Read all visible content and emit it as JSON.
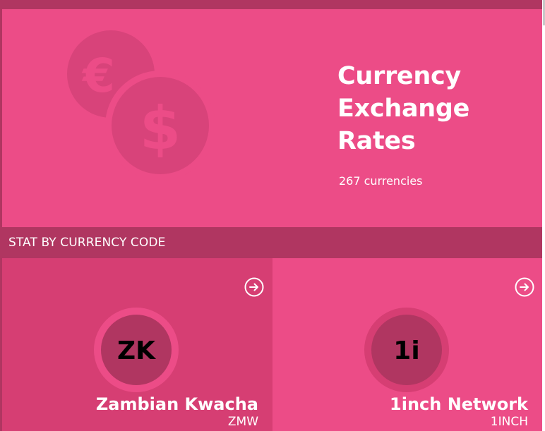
{
  "hero": {
    "title": "Currency Exchange Rates",
    "subtitle": "267 currencies",
    "icons": [
      "euro-coin-icon",
      "dollar-coin-icon"
    ],
    "glyph_euro": "€",
    "glyph_dollar": "$"
  },
  "section": {
    "title": "STAT BY CURRENCY CODE"
  },
  "cards": [
    {
      "badge": "ZK",
      "name": "Zambian Kwacha",
      "code": "ZMW",
      "icon": "arrow-right-circle-icon"
    },
    {
      "badge": "1i",
      "name": "1inch Network",
      "code": "1INCH",
      "icon": "arrow-right-circle-icon"
    }
  ],
  "colors": {
    "hero": "#ec4c87",
    "dark": "#b03661",
    "card_alt": "#d63e73",
    "text": "#ffffff"
  }
}
